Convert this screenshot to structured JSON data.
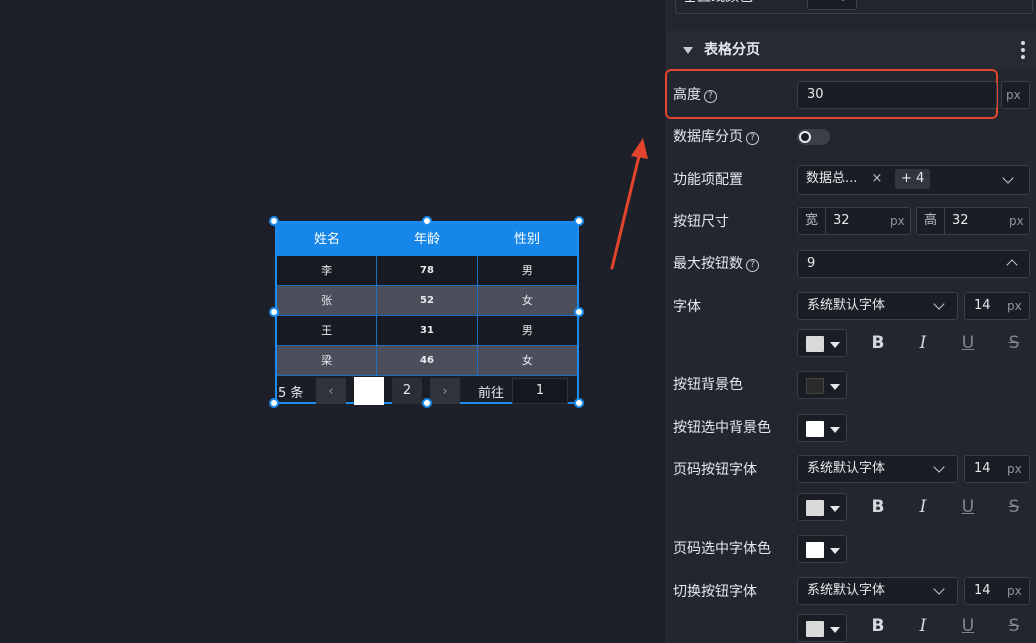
{
  "canvas": {
    "table": {
      "headers": [
        "姓名",
        "年龄",
        "性别"
      ],
      "rows": [
        [
          "李",
          "78",
          "男"
        ],
        [
          "张",
          "52",
          "女"
        ],
        [
          "王",
          "31",
          "男"
        ],
        [
          "梁",
          "46",
          "女"
        ]
      ],
      "pager": {
        "total": "5 条",
        "prev_icon": "‹",
        "page_2": "2",
        "next_icon": "›",
        "goto_label": "前往",
        "goto_value": "1"
      }
    }
  },
  "panel": {
    "top_partial_label": "垂直线颜色",
    "section_title": "表格分页",
    "height": {
      "label": "高度",
      "value": "30",
      "unit": "px",
      "help": "?"
    },
    "db_paging": {
      "label": "数据库分页",
      "help": "?",
      "enabled": false
    },
    "features": {
      "label": "功能项配置",
      "tag": "数据总...",
      "tag_close": "×",
      "more": "+ 4"
    },
    "button_size": {
      "label": "按钮尺寸",
      "width_prefix": "宽",
      "width": "32",
      "height_prefix": "高",
      "height": "32",
      "unit": "px"
    },
    "max_buttons": {
      "label": "最大按钮数",
      "help": "?",
      "value": "9"
    },
    "font": {
      "label": "字体",
      "family": "系统默认字体",
      "size": "14",
      "unit": "px",
      "color": "#d9d9d9"
    },
    "btn_bg": {
      "label": "按钮背景色",
      "color": "#2b2b2b"
    },
    "btn_active_bg": {
      "label": "按钮选中背景色",
      "color": "#ffffff"
    },
    "page_font": {
      "label": "页码按钮字体",
      "family": "系统默认字体",
      "size": "14",
      "unit": "px",
      "color": "#d9d9d9"
    },
    "page_active_color": {
      "label": "页码选中字体色",
      "color": "#ffffff"
    },
    "switch_font": {
      "label": "切换按钮字体",
      "family": "系统默认字体",
      "size": "14",
      "unit": "px",
      "color": "#d9d9d9"
    },
    "format": {
      "bold": "B",
      "italic": "I",
      "underline": "U",
      "strike": "S"
    }
  }
}
